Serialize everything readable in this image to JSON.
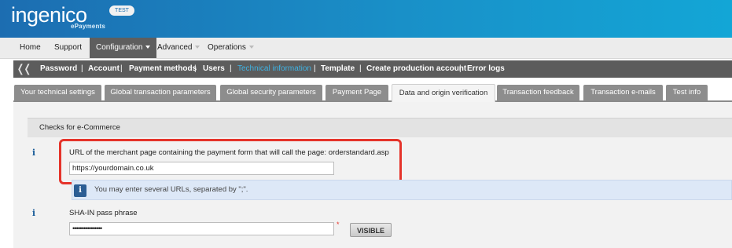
{
  "header": {
    "logo": "ingenico",
    "logo_sub": "ePayments",
    "badge": "TEST"
  },
  "topnav": {
    "items": [
      {
        "label": "Home"
      },
      {
        "label": "Support"
      },
      {
        "label": "Configuration"
      },
      {
        "label": "Advanced"
      },
      {
        "label": "Operations"
      }
    ]
  },
  "subnav": {
    "items": [
      {
        "label": "Password"
      },
      {
        "label": "Account"
      },
      {
        "label": "Payment methods"
      },
      {
        "label": "Users"
      },
      {
        "label": "Technical information"
      },
      {
        "label": "Template"
      },
      {
        "label": "Create production account"
      },
      {
        "label": "Error logs"
      }
    ],
    "separator": "|"
  },
  "tabs": [
    {
      "label": "Your technical settings"
    },
    {
      "label": "Global transaction parameters"
    },
    {
      "label": "Global security parameters"
    },
    {
      "label": "Payment Page"
    },
    {
      "label": "Data and origin verification"
    },
    {
      "label": "Transaction feedback"
    },
    {
      "label": "Transaction e-mails"
    },
    {
      "label": "Test info"
    }
  ],
  "content": {
    "section_title": "Checks for e-Commerce",
    "url_field": {
      "label": "URL of the merchant page containing the payment form that will call the page: orderstandard.asp",
      "value": "https://yourdomain.co.uk"
    },
    "hint": "You may enter several URLs, separated by \";\".",
    "sha_field": {
      "label": "SHA-IN pass phrase",
      "value": "••••••••••••••••",
      "required_marker": "*",
      "visible_button": "VISIBLE"
    },
    "info_glyph": "i"
  }
}
